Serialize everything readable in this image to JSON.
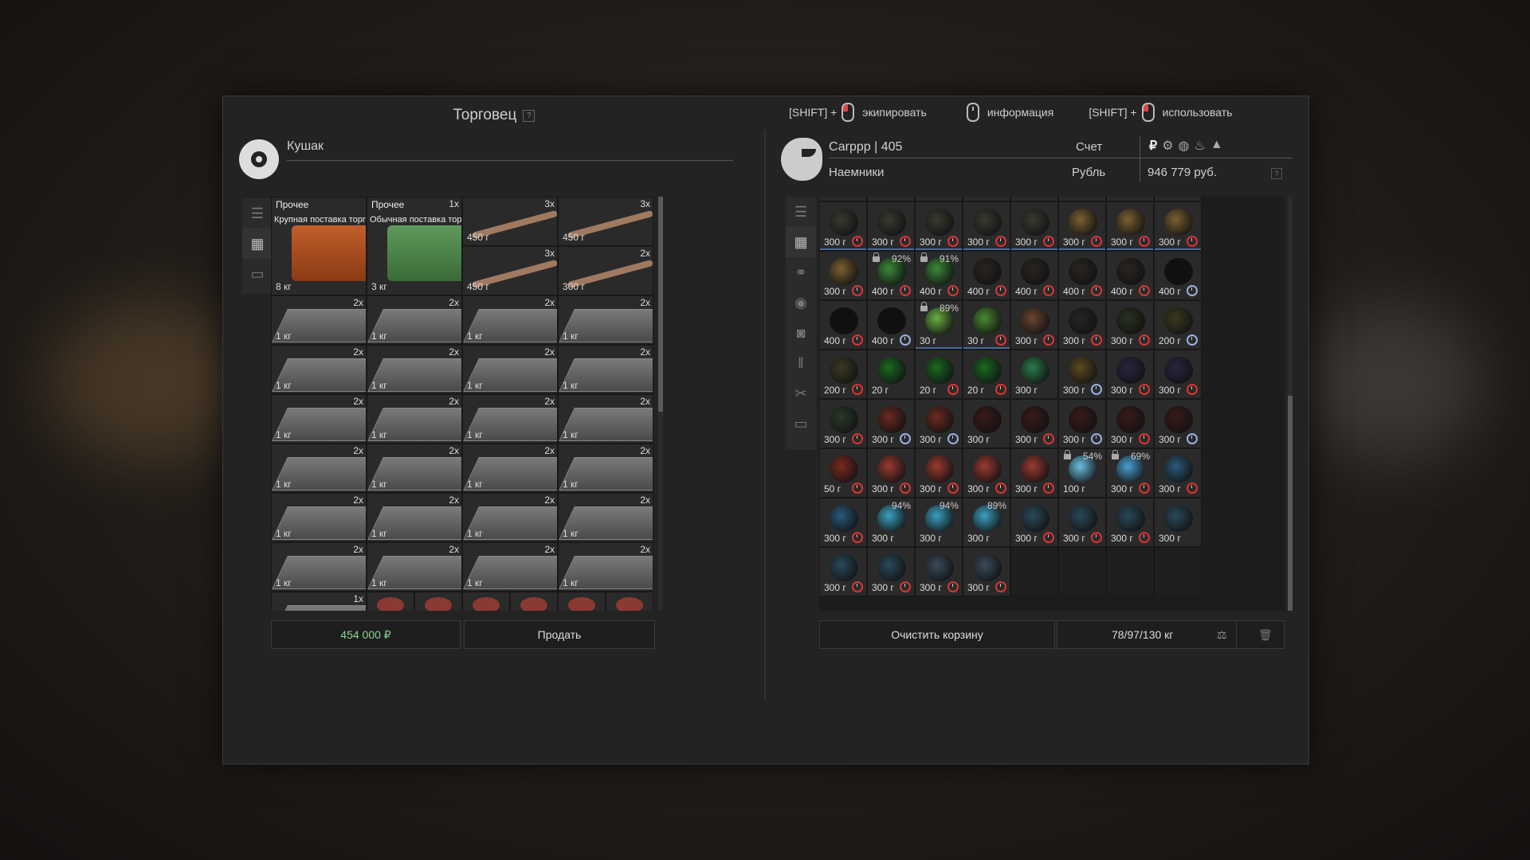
{
  "header": {
    "title": "Торговец",
    "help": "?",
    "hints": [
      {
        "prefix": "[SHIFT] +",
        "mouse": "left",
        "label": "экипировать"
      },
      {
        "prefix": "",
        "mouse": "none",
        "label": "информация"
      },
      {
        "prefix": "[SHIFT] +",
        "mouse": "left",
        "label": "использовать"
      }
    ]
  },
  "trader": {
    "name": "Кушак"
  },
  "trader_items": [
    {
      "type": "box-orange",
      "cat": "Прочее",
      "count": "",
      "desc": "Крупная поставка торго...",
      "weight": "8 кг"
    },
    {
      "type": "box-green",
      "cat": "Прочее",
      "count": "1x",
      "desc": "Обычная поставка торг...",
      "weight": "3 кг"
    },
    {
      "type": "bone",
      "count": "3x",
      "weight": "450 г"
    },
    {
      "type": "bone",
      "count": "3x",
      "weight": "450 г"
    },
    {
      "type": "bone",
      "count": "3x",
      "weight": "450 г"
    },
    {
      "type": "bone",
      "count": "2x",
      "weight": "300 г"
    }
  ],
  "trader_pallet": {
    "count": "2x",
    "weight": "1 кг",
    "rows": 6
  },
  "trader_bottom_row": {
    "first_count": "1x"
  },
  "trader_total": "454 000 ₽",
  "sell_button": "Продать",
  "player": {
    "name": "Саrppp | 405",
    "faction": "Наемники",
    "account_label": "Счет",
    "currency_label": "Рубль",
    "money": "946 779 руб.",
    "currency_icons": [
      "₽",
      "⚙",
      "◍",
      "♨",
      "▲"
    ]
  },
  "player_items": [
    {
      "w": "300 г",
      "c": "#3a3a30",
      "clock": "red"
    },
    {
      "w": "300 г",
      "c": "#3a3a30",
      "clock": "red"
    },
    {
      "w": "300 г",
      "c": "#3a3a30",
      "clock": "red"
    },
    {
      "w": "300 г",
      "c": "#3a3a30",
      "clock": "red"
    },
    {
      "w": "300 г",
      "c": "#3a3a30",
      "clock": "red"
    },
    {
      "w": "300 г",
      "c": "#7a6030",
      "clock": "red"
    },
    {
      "w": "300 г",
      "c": "#7a6030",
      "clock": "red"
    },
    {
      "w": "300 г",
      "c": "#7a6030",
      "clock": "red"
    },
    {
      "w": "300 г",
      "c": "#7a6030",
      "clock": "red"
    },
    {
      "w": "400 г",
      "c": "#3a8a3a",
      "clock": "red",
      "lock": true,
      "pct": "92%"
    },
    {
      "w": "400 г",
      "c": "#3a8a3a",
      "clock": "red",
      "lock": true,
      "pct": "91%"
    },
    {
      "w": "400 г",
      "c": "#2a2520",
      "clock": "red"
    },
    {
      "w": "400 г",
      "c": "#2a2520",
      "clock": "red"
    },
    {
      "w": "400 г",
      "c": "#2a2520",
      "clock": "red"
    },
    {
      "w": "400 г",
      "c": "#2a2520",
      "clock": "red"
    },
    {
      "w": "400 г",
      "c": "#101010",
      "clock": "blue"
    },
    {
      "w": "400 г",
      "c": "#101010",
      "clock": "red"
    },
    {
      "w": "400 г",
      "c": "#101010",
      "clock": "blue"
    },
    {
      "w": "30 г",
      "c": "#6ab040",
      "clock": "",
      "lock": true,
      "pct": "89%"
    },
    {
      "w": "30 г",
      "c": "#4a8a30",
      "clock": "red"
    },
    {
      "w": "300 г",
      "c": "#6a4530",
      "clock": "red"
    },
    {
      "w": "300 г",
      "c": "#252525",
      "clock": "red"
    },
    {
      "w": "300 г",
      "c": "#2a3020",
      "clock": "red"
    },
    {
      "w": "200 г",
      "c": "#3a3a20",
      "clock": "blue"
    },
    {
      "w": "200 г",
      "c": "#3a3a20",
      "clock": "red"
    },
    {
      "w": "20 г",
      "c": "#1a6a20",
      "clock": ""
    },
    {
      "w": "20 г",
      "c": "#1a6a20",
      "clock": "red"
    },
    {
      "w": "20 г",
      "c": "#1a6a20",
      "clock": "red"
    },
    {
      "w": "300 г",
      "c": "#2a7a4a",
      "clock": ""
    },
    {
      "w": "300 г",
      "c": "#5a4a20",
      "clock": "blue"
    },
    {
      "w": "300 г",
      "c": "#2a2540",
      "clock": "red"
    },
    {
      "w": "300 г",
      "c": "#2a2540",
      "clock": "red"
    },
    {
      "w": "300 г",
      "c": "#2a3a2a",
      "clock": "red"
    },
    {
      "w": "300 г",
      "c": "#6a2a20",
      "clock": "blue"
    },
    {
      "w": "300 г",
      "c": "#6a2a20",
      "clock": "blue"
    },
    {
      "w": "300 г",
      "c": "#3a1a1a",
      "clock": ""
    },
    {
      "w": "300 г",
      "c": "#3a1a1a",
      "clock": "red"
    },
    {
      "w": "300 г",
      "c": "#3a1a1a",
      "clock": "blue"
    },
    {
      "w": "300 г",
      "c": "#3a1a1a",
      "clock": "red"
    },
    {
      "w": "300 г",
      "c": "#3a1a1a",
      "clock": "blue"
    },
    {
      "w": "50 г",
      "c": "#7a2a20",
      "clock": "red"
    },
    {
      "w": "300 г",
      "c": "#9a3a30",
      "clock": "red"
    },
    {
      "w": "300 г",
      "c": "#9a3a30",
      "clock": "red"
    },
    {
      "w": "300 г",
      "c": "#9a3a30",
      "clock": "red"
    },
    {
      "w": "300 г",
      "c": "#9a3a30",
      "clock": "red"
    },
    {
      "w": "100 г",
      "c": "#6ac0e0",
      "clock": "",
      "lock": true,
      "pct": "54%"
    },
    {
      "w": "300 г",
      "c": "#4aa0d0",
      "clock": "red",
      "lock": true,
      "pct": "69%"
    },
    {
      "w": "300 г",
      "c": "#2a5a7a",
      "clock": "red"
    },
    {
      "w": "300 г",
      "c": "#2a5a7a",
      "clock": "red"
    },
    {
      "w": "300 г",
      "c": "#3aa0c0",
      "clock": "",
      "pct": "94%"
    },
    {
      "w": "300 г",
      "c": "#3aa0c0",
      "clock": "",
      "pct": "94%"
    },
    {
      "w": "300 г",
      "c": "#3aa0c0",
      "clock": "",
      "pct": "89%"
    },
    {
      "w": "300 г",
      "c": "#2a4a5a",
      "clock": "red"
    },
    {
      "w": "300 г",
      "c": "#2a4a5a",
      "clock": "red"
    },
    {
      "w": "300 г",
      "c": "#2a4a5a",
      "clock": "red"
    },
    {
      "w": "300 г",
      "c": "#2a4a5a",
      "clock": ""
    },
    {
      "w": "300 г",
      "c": "#2a4a5a",
      "clock": "red"
    },
    {
      "w": "300 г",
      "c": "#2a4a5a",
      "clock": "red"
    },
    {
      "w": "300 г",
      "c": "#3a4a5a",
      "clock": "red"
    },
    {
      "w": "300 г",
      "c": "#3a4a5a",
      "clock": "red"
    }
  ],
  "clear_cart": "Очистить корзину",
  "weight_info": "78/97/130 кг",
  "colors": {
    "accent_green": "#7ec07e",
    "clock_red": "#d33333",
    "clock_blue": "#9ab0e0"
  }
}
